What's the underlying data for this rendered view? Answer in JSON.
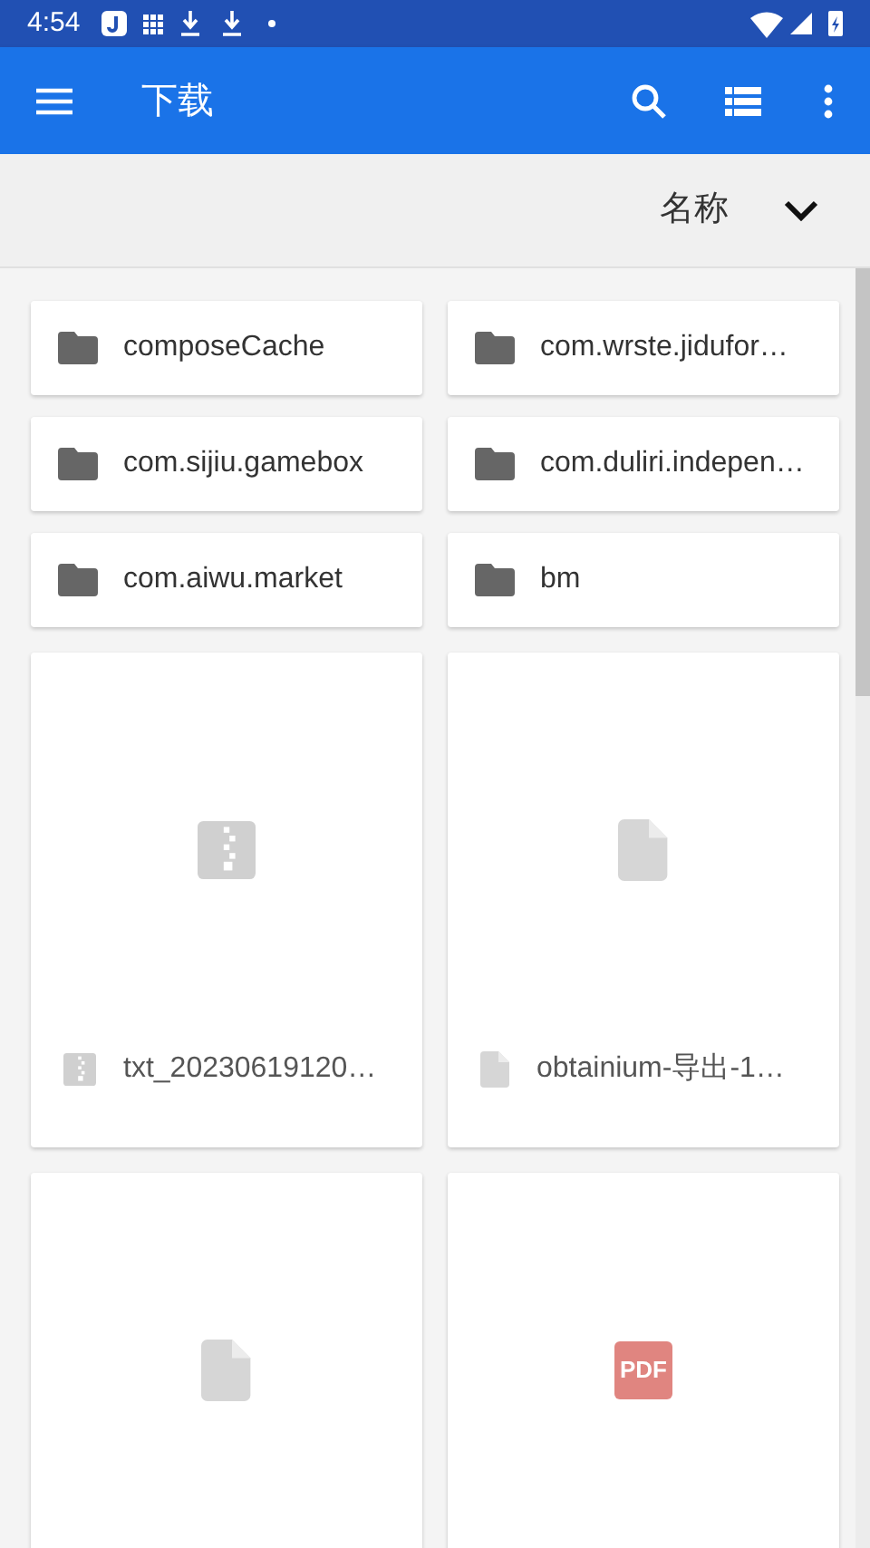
{
  "status_bar": {
    "time": "4:54"
  },
  "app_bar": {
    "title": "下载"
  },
  "sort": {
    "label": "名称"
  },
  "folders": [
    {
      "name": "composeCache"
    },
    {
      "name": "com.wrste.jidufor…"
    },
    {
      "name": "com.sijiu.gamebox"
    },
    {
      "name": "com.duliri.indepen…"
    },
    {
      "name": "com.aiwu.market"
    },
    {
      "name": "bm"
    }
  ],
  "files": [
    {
      "kind": "archive",
      "name": "txt_20230619120…"
    },
    {
      "kind": "document",
      "name": "obtainium-导出-1…"
    },
    {
      "kind": "document"
    },
    {
      "kind": "pdf",
      "icon_text": "PDF"
    }
  ]
}
